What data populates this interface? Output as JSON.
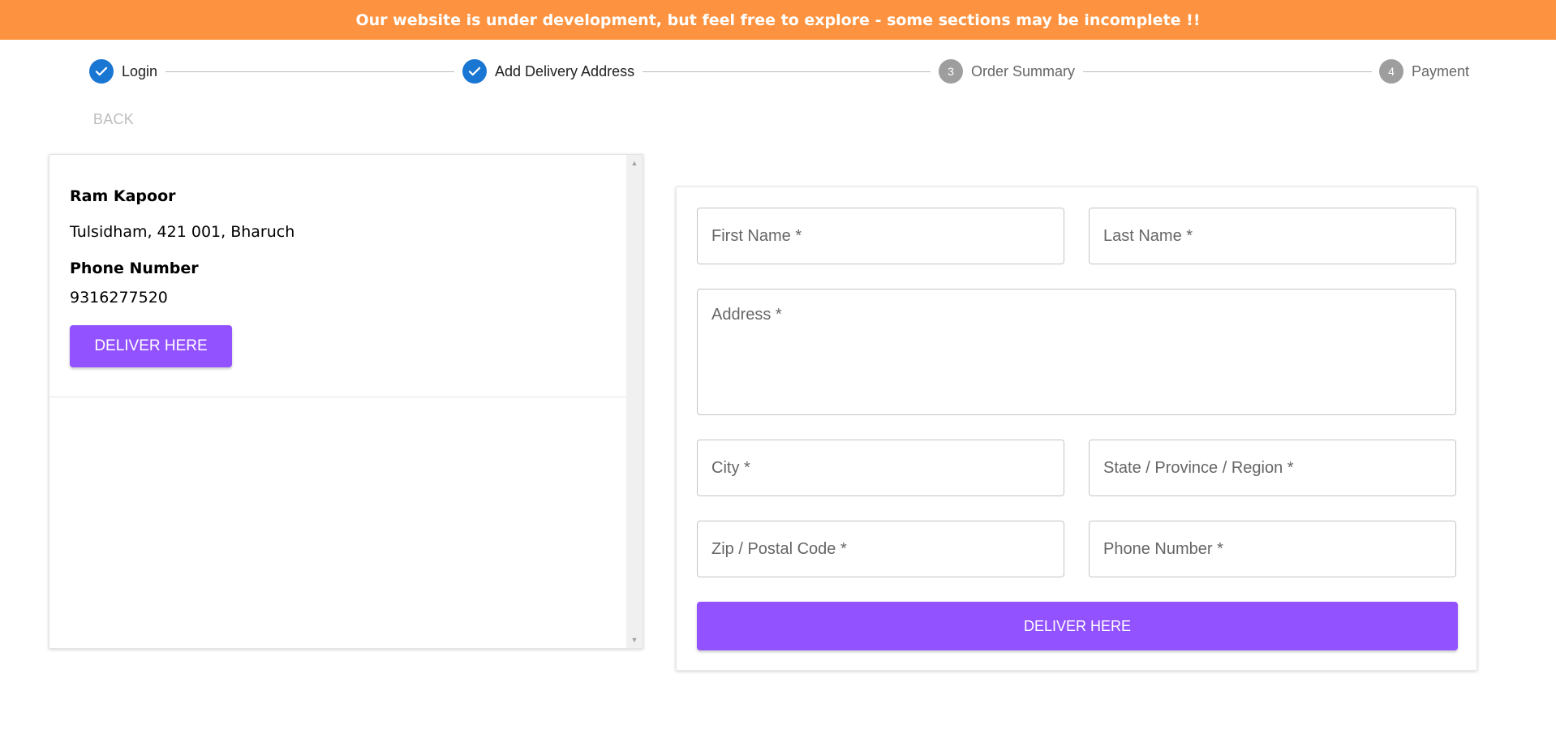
{
  "banner": {
    "text": "Our website is under development, but feel free to explore - some sections may be incomplete !!",
    "color": "#fd9340"
  },
  "stepper": {
    "steps": [
      {
        "label": "Login",
        "status": "completed",
        "icon": "check-icon"
      },
      {
        "label": "Add Delivery Address",
        "status": "completed",
        "icon": "check-icon"
      },
      {
        "label": "Order Summary",
        "status": "pending",
        "number": "3"
      },
      {
        "label": "Payment",
        "status": "pending",
        "number": "4"
      }
    ],
    "completed_color": "#1976d2",
    "pending_color": "#9e9e9e"
  },
  "back_label": "BACK",
  "saved_address": {
    "name": "Ram Kapoor",
    "address_line": "Tulsidham, 421 001, Bharuch",
    "phone_label": "Phone Number",
    "phone": "9316277520",
    "deliver_label": "DELIVER HERE"
  },
  "form": {
    "first_name_placeholder": "First Name *",
    "last_name_placeholder": "Last Name *",
    "address_placeholder": "Address *",
    "city_placeholder": "City *",
    "state_placeholder": "State / Province / Region *",
    "zip_placeholder": "Zip / Postal Code *",
    "phone_placeholder": "Phone Number *",
    "submit_label": "DELIVER HERE",
    "accent_color": "#9352ff"
  }
}
